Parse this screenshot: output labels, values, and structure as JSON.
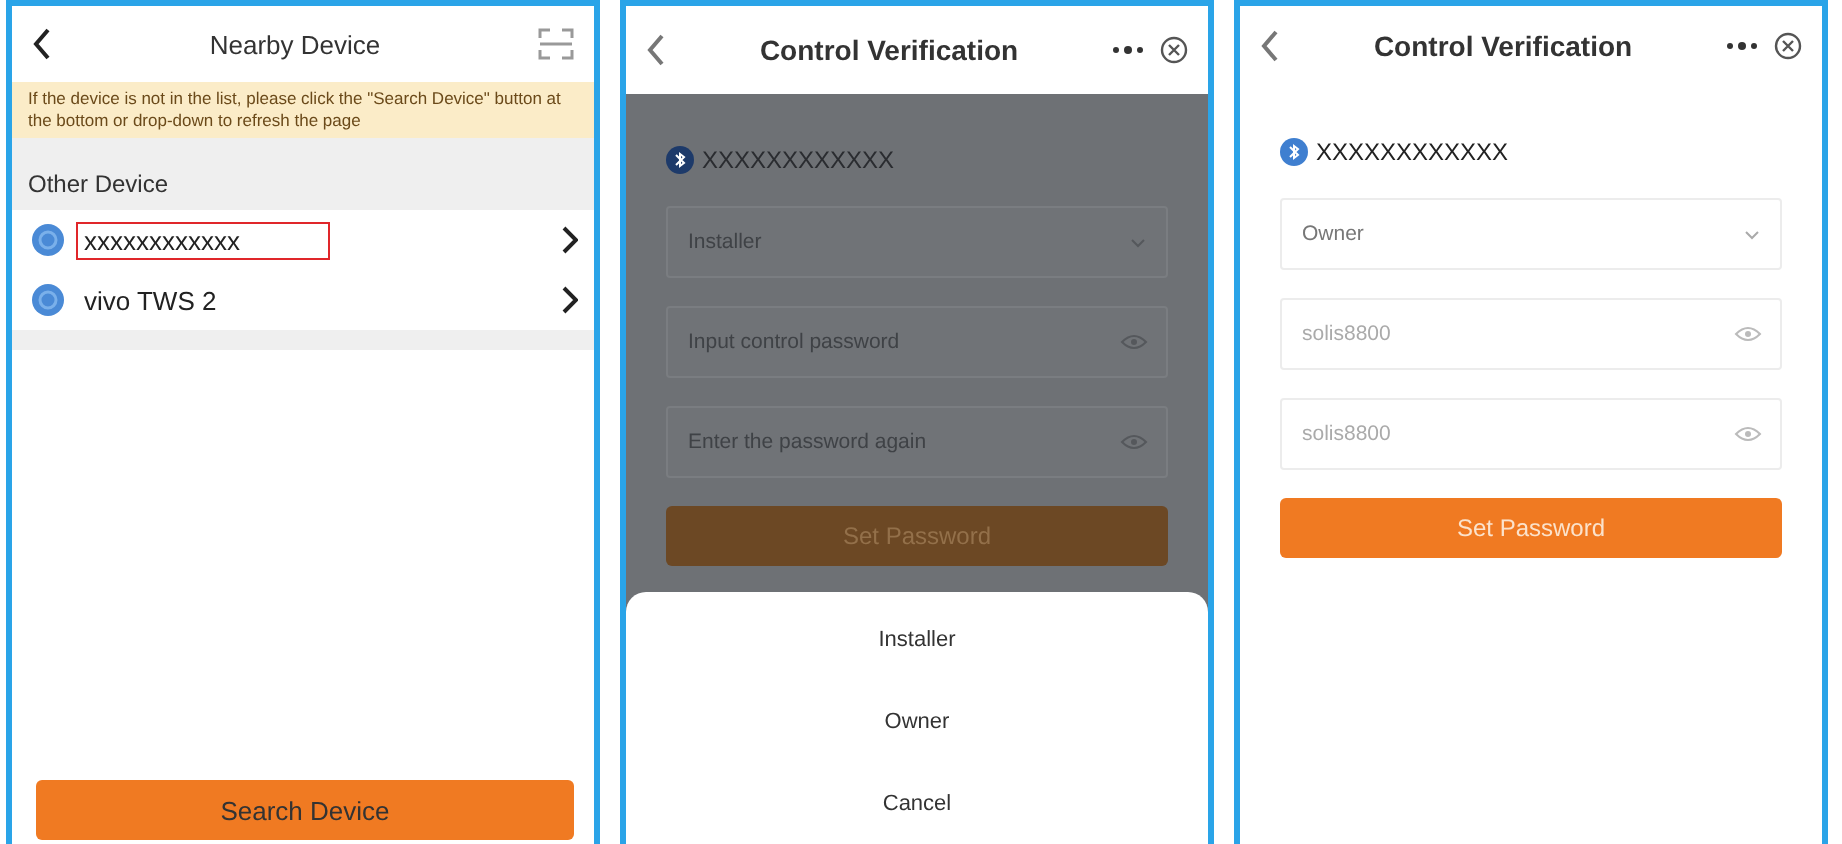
{
  "screens": [
    {
      "kind": "device_list",
      "title": "Nearby Device",
      "notice": "If the device is not in the list, please click the \"Search Device\" button at the bottom or drop-down to refresh the page",
      "section": "Other Device",
      "devices": [
        {
          "name": "xxxxxxxxxxxx",
          "highlighted": true
        },
        {
          "name": "vivo TWS 2",
          "highlighted": false
        }
      ],
      "button": "Search Device"
    },
    {
      "kind": "verification",
      "title": "Control Verification",
      "dimmed": true,
      "device": "XXXXXXXXXXXX",
      "role": "Installer",
      "fields": [
        {
          "placeholder": "Input control password"
        },
        {
          "placeholder": "Enter the password again"
        }
      ],
      "button": "Set Password",
      "sheet": {
        "options": [
          "Installer",
          "Owner"
        ],
        "cancel": "Cancel"
      }
    },
    {
      "kind": "verification",
      "title": "Control Verification",
      "dimmed": false,
      "device": "XXXXXXXXXXXX",
      "role": "Owner",
      "fields": [
        {
          "value": "solis8800"
        },
        {
          "value": "solis8800"
        }
      ],
      "button": "Set Password"
    }
  ]
}
